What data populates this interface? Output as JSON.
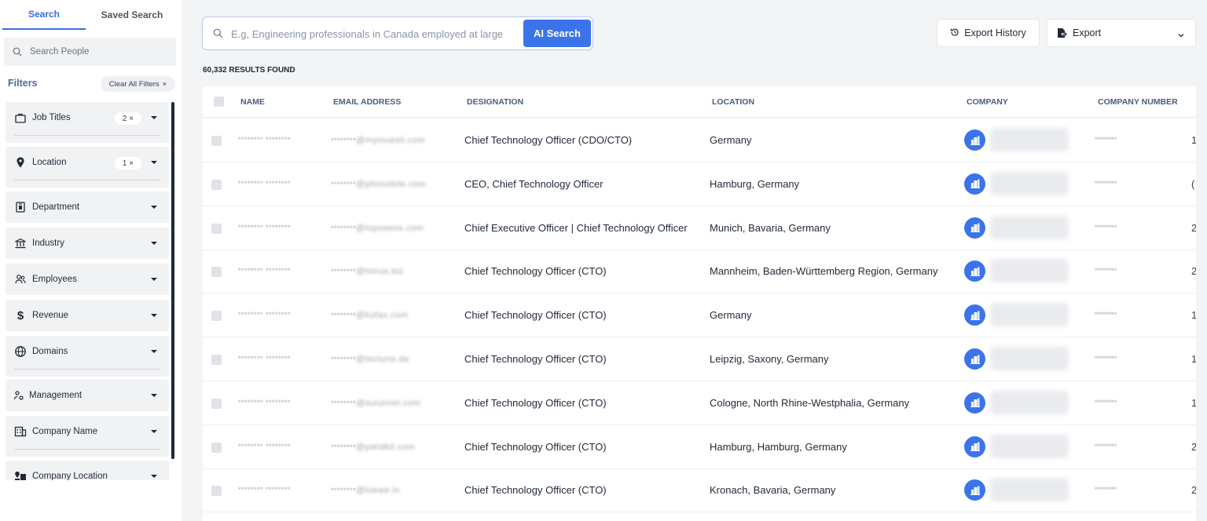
{
  "sidebar": {
    "tabs": {
      "search": "Search",
      "saved": "Saved Search"
    },
    "search_placeholder": "Search People",
    "filters_label": "Filters",
    "clear_all": "Clear All Filters",
    "clear_x": "×",
    "filters": [
      {
        "label": "Job Titles",
        "icon": "briefcase-icon",
        "count": "2 ×"
      },
      {
        "label": "Location",
        "icon": "location-pin-icon",
        "count": "1 ×"
      },
      {
        "label": "Department",
        "icon": "department-icon"
      },
      {
        "label": "Industry",
        "icon": "bank-icon"
      },
      {
        "label": "Employees",
        "icon": "people-icon"
      },
      {
        "label": "Revenue",
        "icon": "dollar-icon"
      },
      {
        "label": "Domains",
        "icon": "globe-icon"
      },
      {
        "label": "Management",
        "icon": "management-icon"
      },
      {
        "label": "Company Name",
        "icon": "building-icon"
      },
      {
        "label": "Company Location",
        "icon": "company-location-icon"
      }
    ]
  },
  "main": {
    "ai_search": {
      "placeholder": "E.g, Engineering professionals in Canada employed at large",
      "button": "AI Search"
    },
    "export_history": "Export History",
    "export": "Export",
    "results_count": "60,332 RESULTS FOUND",
    "columns": [
      "NAME",
      "EMAIL ADDRESS",
      "DESIGNATION",
      "LOCATION",
      "COMPANY",
      "COMPANY NUMBER"
    ],
    "rows": [
      {
        "name": "******** ********",
        "email_prefix": "********",
        "email_domain": "@mymuesli.com",
        "designation": "Chief Technology Officer (CDO/CTO)",
        "location": "Germany",
        "company_number": "********",
        "edge": "1"
      },
      {
        "name": "******** ********",
        "email_prefix": "********",
        "email_domain": "@phimobile.com",
        "designation": "CEO, Chief Technology Officer",
        "location": "Hamburg, Germany",
        "company_number": "********",
        "edge": "("
      },
      {
        "name": "******** ********",
        "email_prefix": "********",
        "email_domain": "@toposens.com",
        "designation": "Chief Executive Officer | Chief Technology Officer",
        "location": "Munich, Bavaria, Germany",
        "company_number": "********",
        "edge": "2"
      },
      {
        "name": "******** ********",
        "email_prefix": "********",
        "email_domain": "@horus.biz",
        "designation": "Chief Technology Officer (CTO)",
        "location": "Mannheim, Baden-Württemberg Region, Germany",
        "company_number": "********",
        "edge": "2"
      },
      {
        "name": "******** ********",
        "email_prefix": "********",
        "email_domain": "@kofax.com",
        "designation": "Chief Technology Officer (CTO)",
        "location": "Germany",
        "company_number": "********",
        "edge": "1"
      },
      {
        "name": "******** ********",
        "email_prefix": "********",
        "email_domain": "@lecturio.de",
        "designation": "Chief Technology Officer (CTO)",
        "location": "Leipzig, Saxony, Germany",
        "company_number": "********",
        "edge": "1"
      },
      {
        "name": "******** ********",
        "email_prefix": "********",
        "email_domain": "@sunzinet.com",
        "designation": "Chief Technology Officer (CTO)",
        "location": "Cologne, North Rhine-Westphalia, Germany",
        "company_number": "********",
        "edge": "1"
      },
      {
        "name": "******** ********",
        "email_prefix": "********",
        "email_domain": "@yieldkit.com",
        "designation": "Chief Technology Officer (CTO)",
        "location": "Hamburg, Hamburg, Germany",
        "company_number": "********",
        "edge": "2"
      },
      {
        "name": "******** ********",
        "email_prefix": "********",
        "email_domain": "@loewe.tv",
        "designation": "Chief Technology Officer (CTO)",
        "location": "Kronach, Bavaria, Germany",
        "company_number": "********",
        "edge": "2"
      }
    ]
  },
  "colors": {
    "accent": "#3b74ea",
    "tab_active": "#3b6fe0",
    "sidebar_bg": "#ffffff",
    "main_bg": "#f3f4f6"
  }
}
